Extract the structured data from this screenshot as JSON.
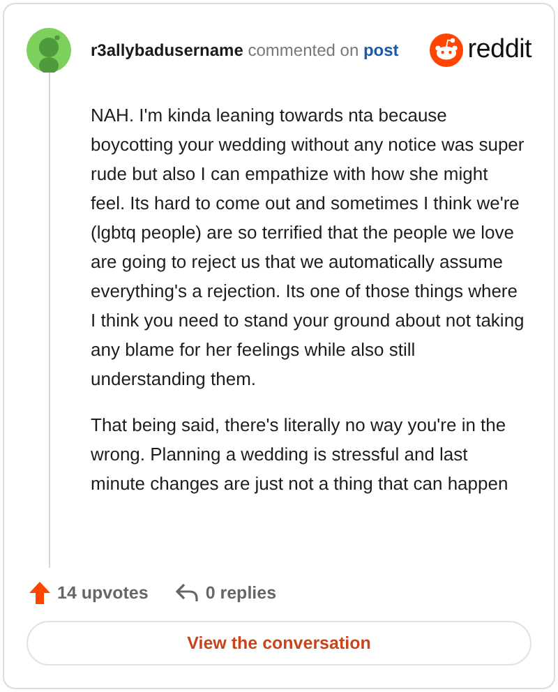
{
  "header": {
    "username": "r3allybadusername",
    "action": "commented on",
    "target": "post",
    "brand": "reddit"
  },
  "comment": {
    "paragraphs": [
      "NAH. I'm kinda leaning towards nta because boycotting your wedding without any notice was super rude but also I can empathize with how she might feel. Its hard to come out and sometimes I think we're (lgbtq people) are so terrified that the people we love are going to reject us that we automatically assume everything's a rejection. Its one of those things where I think you need to stand your ground about not taking any blame for her feelings while also still understanding them.",
      "That being said, there's literally no way you're in the wrong. Planning a wedding is stressful and last minute changes are just not a thing that can happen"
    ]
  },
  "footer": {
    "upvotes": "14 upvotes",
    "replies": "0 replies"
  },
  "button": "View the conversation"
}
